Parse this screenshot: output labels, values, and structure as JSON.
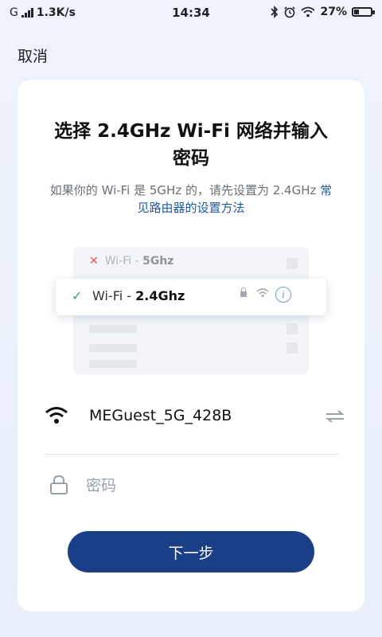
{
  "status_bar": {
    "network": "G",
    "speed": "1.3K/s",
    "time": "14:34",
    "battery": "27%"
  },
  "header": {
    "cancel_label": "取消"
  },
  "card": {
    "title": "选择 2.4GHz Wi-Fi 网络并输入密码",
    "hint_text": "如果你的 Wi-Fi 是 5GHz 的，请先设置为 2.4GHz",
    "hint_link": "常见路由器的设置方法",
    "illustration": {
      "row_5g_prefix": "Wi-Fi - ",
      "row_5g_band": "5Ghz",
      "row_24g_prefix": "Wi-Fi - ",
      "row_24g_band": "2.4Ghz",
      "info_glyph": "i"
    },
    "wifi": {
      "ssid": "MEGuest_5G_428B"
    },
    "password": {
      "placeholder": "密码",
      "value": ""
    },
    "next_label": "下一步"
  },
  "colors": {
    "primary_button": "#1b3f86",
    "link": "#1f5aa6",
    "check": "#2aa58a",
    "cross": "#e05555"
  },
  "icons": [
    "signal-bars-icon",
    "bluetooth-icon",
    "alarm-icon",
    "wifi-icon",
    "battery-icon",
    "check-icon",
    "cross-icon",
    "lock-icon",
    "info-icon",
    "swap-icon"
  ]
}
